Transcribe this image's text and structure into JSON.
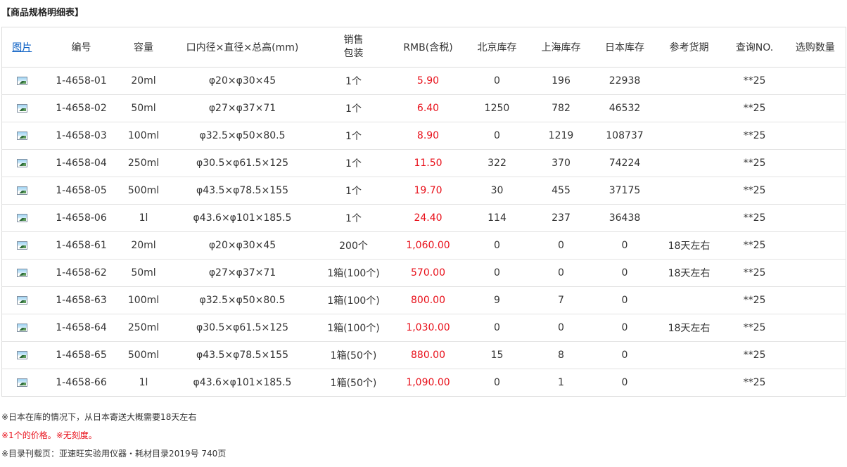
{
  "title": "【商品规格明细表】",
  "table": {
    "headers": {
      "image": "图片",
      "code": "编号",
      "capacity": "容量",
      "dimensions": "口内径×直径×总高(mm)",
      "packaging": "销售\n包装",
      "price": "RMB(含税)",
      "beijing_stock": "北京库存",
      "shanghai_stock": "上海库存",
      "japan_stock": "日本库存",
      "lead_time": "参考货期",
      "inquiry": "查询NO.",
      "purchase_qty": "选购数量"
    },
    "rows": [
      {
        "code": "1-4658-01",
        "capacity": "20ml",
        "dimensions": "φ20×φ30×45",
        "packaging": "1个",
        "price": "5.90",
        "beijing": "0",
        "shanghai": "196",
        "japan": "22938",
        "lead_time": "",
        "inquiry": "**25"
      },
      {
        "code": "1-4658-02",
        "capacity": "50ml",
        "dimensions": "φ27×φ37×71",
        "packaging": "1个",
        "price": "6.40",
        "beijing": "1250",
        "shanghai": "782",
        "japan": "46532",
        "lead_time": "",
        "inquiry": "**25"
      },
      {
        "code": "1-4658-03",
        "capacity": "100ml",
        "dimensions": "φ32.5×φ50×80.5",
        "packaging": "1个",
        "price": "8.90",
        "beijing": "0",
        "shanghai": "1219",
        "japan": "108737",
        "lead_time": "",
        "inquiry": "**25"
      },
      {
        "code": "1-4658-04",
        "capacity": "250ml",
        "dimensions": "φ30.5×φ61.5×125",
        "packaging": "1个",
        "price": "11.50",
        "beijing": "322",
        "shanghai": "370",
        "japan": "74224",
        "lead_time": "",
        "inquiry": "**25"
      },
      {
        "code": "1-4658-05",
        "capacity": "500ml",
        "dimensions": "φ43.5×φ78.5×155",
        "packaging": "1个",
        "price": "19.70",
        "beijing": "30",
        "shanghai": "455",
        "japan": "37175",
        "lead_time": "",
        "inquiry": "**25"
      },
      {
        "code": "1-4658-06",
        "capacity": "1l",
        "dimensions": "φ43.6×φ101×185.5",
        "packaging": "1个",
        "price": "24.40",
        "beijing": "114",
        "shanghai": "237",
        "japan": "36438",
        "lead_time": "",
        "inquiry": "**25"
      },
      {
        "code": "1-4658-61",
        "capacity": "20ml",
        "dimensions": "φ20×φ30×45",
        "packaging": "200个",
        "price": "1,060.00",
        "beijing": "0",
        "shanghai": "0",
        "japan": "0",
        "lead_time": "18天左右",
        "inquiry": "**25"
      },
      {
        "code": "1-4658-62",
        "capacity": "50ml",
        "dimensions": "φ27×φ37×71",
        "packaging": "1箱(100个)",
        "price": "570.00",
        "beijing": "0",
        "shanghai": "0",
        "japan": "0",
        "lead_time": "18天左右",
        "inquiry": "**25"
      },
      {
        "code": "1-4658-63",
        "capacity": "100ml",
        "dimensions": "φ32.5×φ50×80.5",
        "packaging": "1箱(100个)",
        "price": "800.00",
        "beijing": "9",
        "shanghai": "7",
        "japan": "0",
        "lead_time": "",
        "inquiry": "**25"
      },
      {
        "code": "1-4658-64",
        "capacity": "250ml",
        "dimensions": "φ30.5×φ61.5×125",
        "packaging": "1箱(100个)",
        "price": "1,030.00",
        "beijing": "0",
        "shanghai": "0",
        "japan": "0",
        "lead_time": "18天左右",
        "inquiry": "**25"
      },
      {
        "code": "1-4658-65",
        "capacity": "500ml",
        "dimensions": "φ43.5×φ78.5×155",
        "packaging": "1箱(50个)",
        "price": "880.00",
        "beijing": "15",
        "shanghai": "8",
        "japan": "0",
        "lead_time": "",
        "inquiry": "**25"
      },
      {
        "code": "1-4658-66",
        "capacity": "1l",
        "dimensions": "φ43.6×φ101×185.5",
        "packaging": "1箱(50个)",
        "price": "1,090.00",
        "beijing": "0",
        "shanghai": "1",
        "japan": "0",
        "lead_time": "",
        "inquiry": "**25"
      }
    ]
  },
  "notes": [
    {
      "text": "※日本在库的情况下，从日本寄送大概需要18天左右",
      "color": "#333333"
    },
    {
      "text": "※1个的价格。※无刻度。",
      "color": "#e8101a"
    },
    {
      "text": "※目录刊载页：亚速旺实验用仪器・耗材目录2019号 740页",
      "color": "#333333"
    }
  ],
  "colors": {
    "price": "#e8101a",
    "link": "#0a5fc4",
    "border": "#dcdcdc"
  },
  "icons": {
    "thumbnail": "image-thumbnail-icon"
  }
}
